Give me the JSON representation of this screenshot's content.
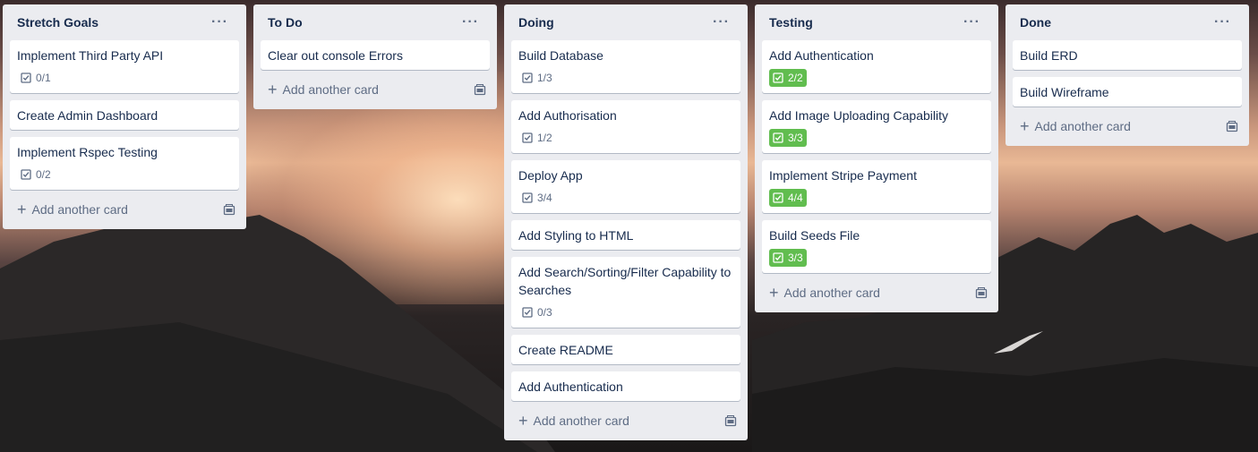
{
  "lists": [
    {
      "title": "Stretch Goals",
      "cards": [
        {
          "title": "Implement Third Party API",
          "checklist": "0/1",
          "complete": false
        },
        {
          "title": "Create Admin Dashboard"
        },
        {
          "title": "Implement Rspec Testing",
          "checklist": "0/2",
          "complete": false
        }
      ],
      "add_label": "Add another card"
    },
    {
      "title": "To Do",
      "cards": [
        {
          "title": "Clear out console Errors"
        }
      ],
      "add_label": "Add another card"
    },
    {
      "title": "Doing",
      "cards": [
        {
          "title": "Build Database",
          "checklist": "1/3",
          "complete": false
        },
        {
          "title": "Add Authorisation",
          "checklist": "1/2",
          "complete": false
        },
        {
          "title": "Deploy App",
          "checklist": "3/4",
          "complete": false
        },
        {
          "title": "Add Styling to HTML"
        },
        {
          "title": "Add Search/Sorting/Filter Capability to Searches",
          "checklist": "0/3",
          "complete": false
        },
        {
          "title": "Create README"
        },
        {
          "title": "Add Authentication"
        }
      ],
      "add_label": "Add another card"
    },
    {
      "title": "Testing",
      "cards": [
        {
          "title": "Add Authentication",
          "checklist": "2/2",
          "complete": true
        },
        {
          "title": "Add Image Uploading Capability",
          "checklist": "3/3",
          "complete": true
        },
        {
          "title": "Implement Stripe Payment",
          "checklist": "4/4",
          "complete": true
        },
        {
          "title": "Build Seeds File",
          "checklist": "3/3",
          "complete": true
        }
      ],
      "add_label": "Add another card"
    },
    {
      "title": "Done",
      "cards": [
        {
          "title": "Build ERD"
        },
        {
          "title": "Build Wireframe"
        }
      ],
      "add_label": "Add another card"
    }
  ],
  "list_menu_icon": "more-horizontal-icon",
  "checklist_icon": "checkbox-icon",
  "template_icon": "card-template-icon",
  "colors": {
    "list_bg": "#ebecf0",
    "complete_badge": "#61bd4f",
    "text": "#172b4d",
    "muted": "#5e6c84"
  }
}
